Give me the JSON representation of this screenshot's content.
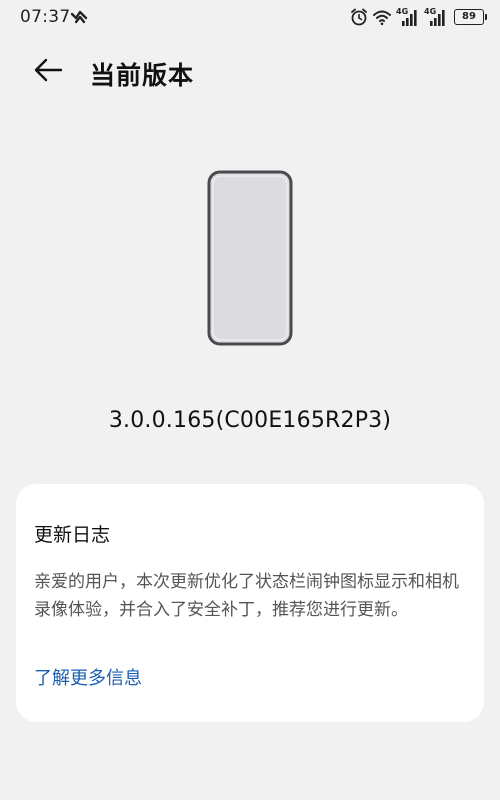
{
  "status_bar": {
    "time": "07:37",
    "network_tag_1": "4G",
    "network_tag_2": "4G",
    "battery_level": "89",
    "icons": [
      "alarm-icon",
      "wifi-icon",
      "signal-icon",
      "signal-icon",
      "battery-icon"
    ]
  },
  "header": {
    "title": "当前版本",
    "back_icon": "back-arrow-icon"
  },
  "device": {
    "illustration": "phone-illustration",
    "version": "3.0.0.165(C00E165R2P3)"
  },
  "changelog": {
    "title": "更新日志",
    "description": "亲爱的用户，本次更新优化了状态栏闹钟图标显示和相机录像体验，并合入了安全补丁，推荐您进行更新。",
    "link_label": "了解更多信息",
    "link_color": "#1a5fb4"
  }
}
